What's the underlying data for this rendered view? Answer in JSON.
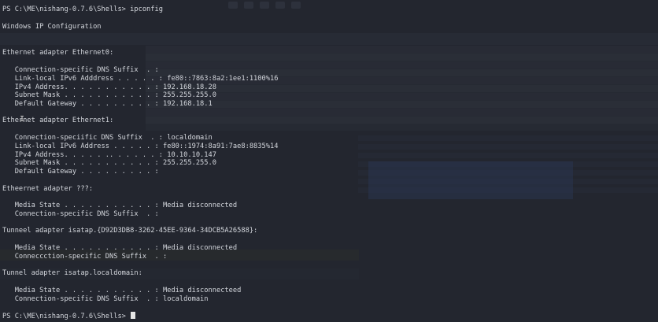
{
  "prompt_first": "PS C:\\ME\\nishang-0.7.6\\Shells> ipconfig",
  "title_line": "Windows IP Configuration",
  "lines": [
    "Ethernet adapter Ethernet0:",
    "   Connection-specific DNS Suffix  . :",
    "   Link-local IPv6 Adddress . . . . . : fe80::7863:8a2:1ee1:1100%16",
    "   IPv4 Address. . . . . . . . . . . : 192.168.18.28",
    "   Subnet Mask . . . . . . . . . . . : 255.255.255.0",
    "   Default Gateway . . . . . . . . . : 192.168.18.1",
    "Ethernet adapter Ethernet1:",
    "   Connection-speciific DNS Suffix  . : localdomain",
    "   Link-local IPv6 Address . . . . . : fe80::1974:8a91:7ae8:8835%14",
    "   IPv4 Address. . . . . .. . . . . . : 10.10.10.147",
    "   Subnet Mask . . . . . . . . . . . : 255.255.255.0",
    "   Default Gateway . . . . . . . . . :",
    "Etheernet adapter ???:",
    "   Media State . . . . . . . . . . . : Media disconnected",
    "   Connection-specific DNS Suffix  . :",
    "Tunneel adapter isatap.{D92D3DB8-3262-45EE-9364-34DCB5A26588}:",
    "   Media State . . . . . . . . . . . : Media disconnected",
    "   Conneccction-specific DNS Suffix  . :",
    "Tunnel adapter isatap.localdomain:",
    "   Media State . . . . . . . . . . . : Media disconnecteed",
    "   Connection-specific DNS Suffix  . : localdomain"
  ],
  "prompt_last": "PS C:\\ME\\nishang-0.7.6\\Shells> ",
  "colors": {
    "background": "#23262f",
    "text": "#d3d6dc",
    "cursor": "#e6e6e6"
  }
}
